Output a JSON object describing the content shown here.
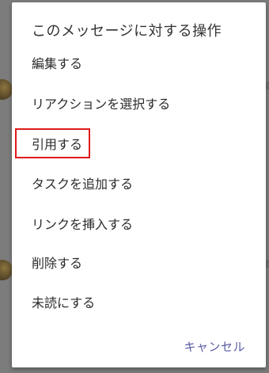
{
  "dialog": {
    "title": "このメッセージに対する操作",
    "items": [
      {
        "label": "編集する"
      },
      {
        "label": "リアクションを選択する"
      },
      {
        "label": "引用する"
      },
      {
        "label": "タスクを追加する"
      },
      {
        "label": "リンクを挿入する"
      },
      {
        "label": "削除する"
      },
      {
        "label": "未読にする"
      }
    ],
    "cancel_label": "キャンセル"
  },
  "colors": {
    "overlay": "#7c7c7c",
    "dialog_background": "#ffffff",
    "highlight": "#e01a1a",
    "cancel_accent": "#5b5ba6"
  }
}
